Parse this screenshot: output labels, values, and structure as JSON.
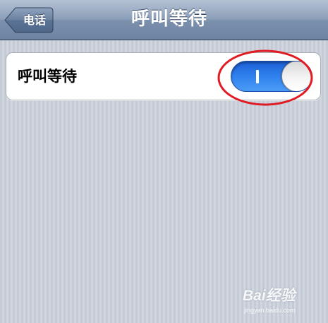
{
  "navbar": {
    "back_label": "电话",
    "title": "呼叫等待"
  },
  "setting": {
    "label": "呼叫等待",
    "toggle_state": "on",
    "toggle_on_glyph": "I"
  },
  "colors": {
    "navbar_accent": "#7b90ad",
    "toggle_on": "#2f82ee",
    "highlight_ring": "#e01b24"
  },
  "icons": {
    "back": "back-arrow-icon",
    "knob": "toggle-knob"
  },
  "watermark": {
    "logo": "Bai经验",
    "url": "jingyan.baidu.com"
  }
}
